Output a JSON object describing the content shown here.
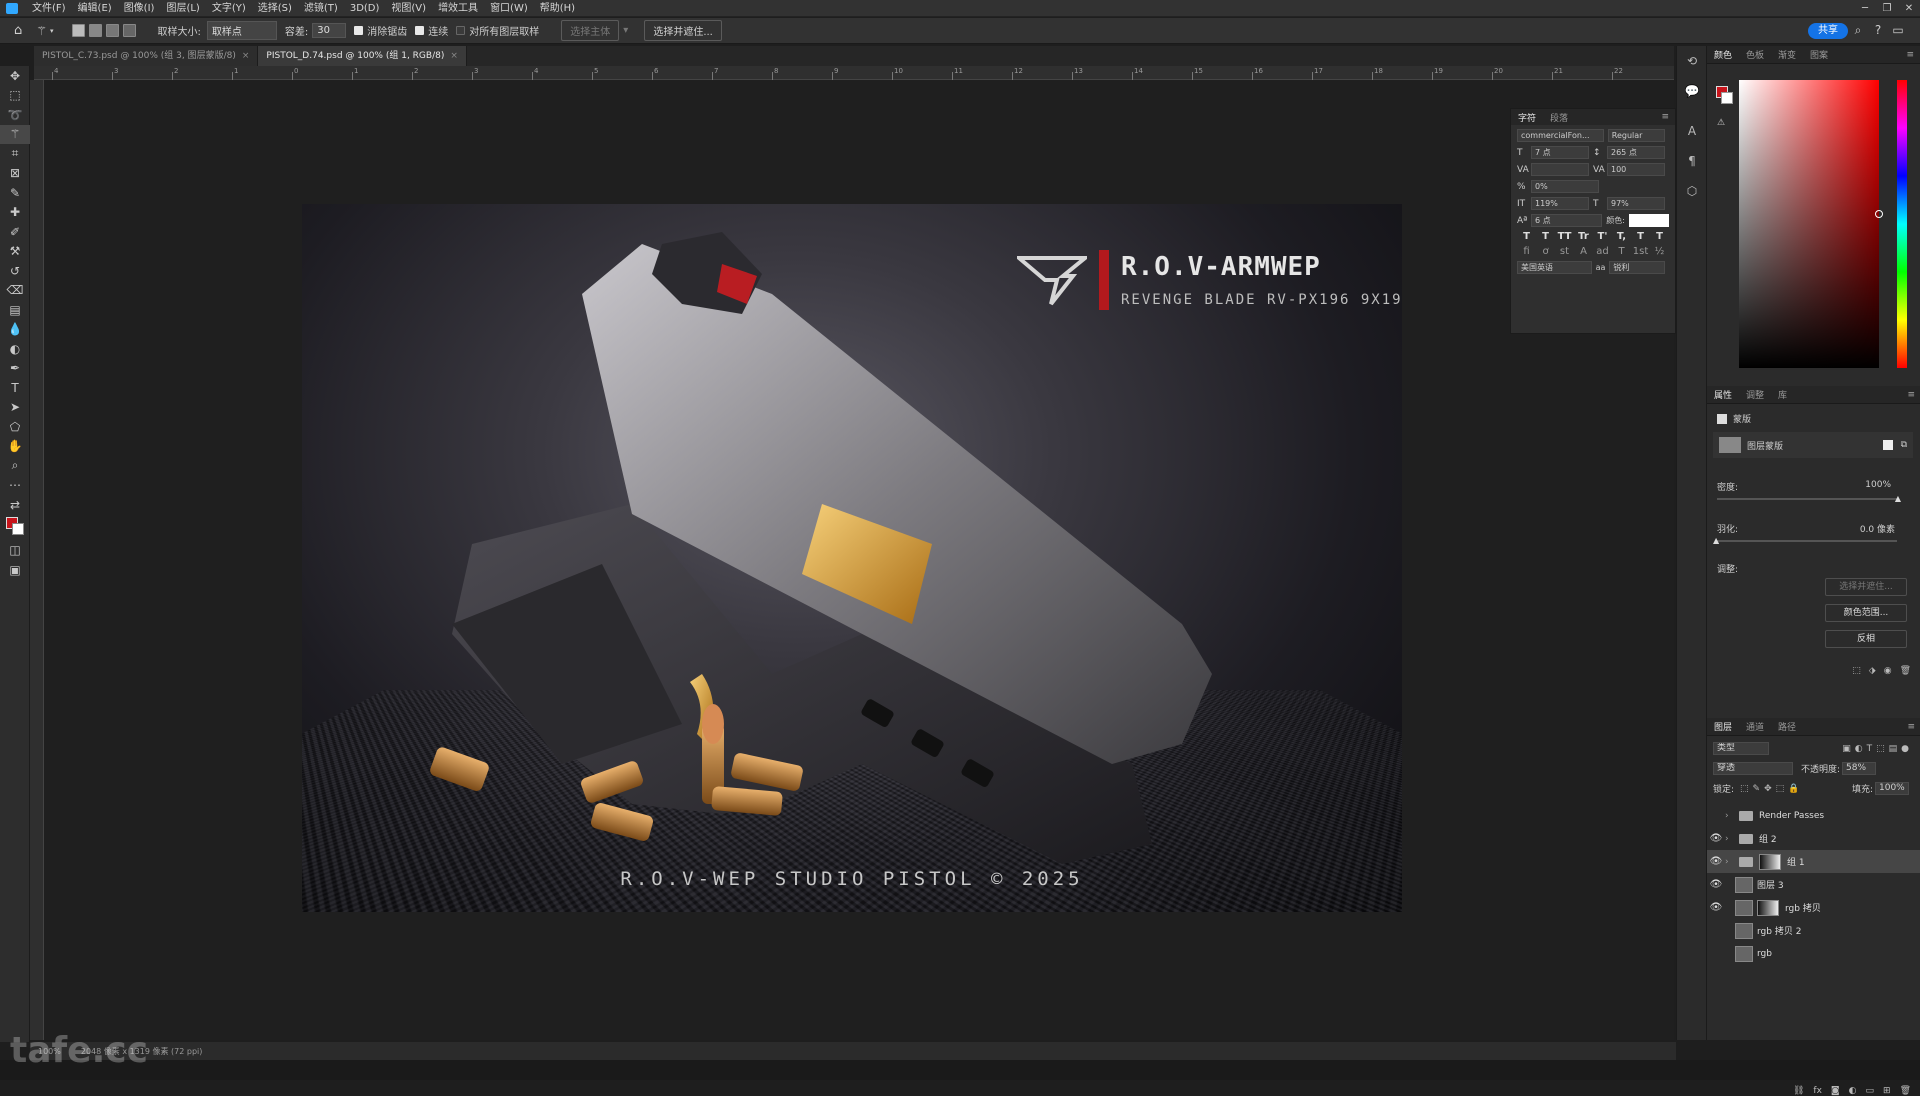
{
  "menu": {
    "items": [
      "文件(F)",
      "编辑(E)",
      "图像(I)",
      "图层(L)",
      "文字(Y)",
      "选择(S)",
      "滤镜(T)",
      "3D(D)",
      "视图(V)",
      "增效工具",
      "窗口(W)",
      "帮助(H)"
    ]
  },
  "options": {
    "sample_size_label": "取样大小:",
    "sample_size_value": "取样点",
    "tolerance_label": "容差:",
    "tolerance_value": "30",
    "antialias": "消除锯齿",
    "contiguous": "连续",
    "sample_all": "对所有图层取样",
    "select_subject": "选择主体",
    "select_and_mask": "选择并遮住..."
  },
  "share_label": "共享",
  "tabs": [
    {
      "label": "PISTOL_C.73.psd @ 100% (组 3, 图层蒙版/8)",
      "close": "×"
    },
    {
      "label": "PISTOL_D.74.psd @ 100% (组 1, RGB/8)",
      "close": "×"
    }
  ],
  "ruler_ticks": [
    "4",
    "3",
    "2",
    "1",
    "0",
    "1",
    "2",
    "3",
    "4",
    "5",
    "6",
    "7",
    "8",
    "9",
    "10",
    "11",
    "12",
    "13",
    "14",
    "15",
    "16",
    "17",
    "18",
    "19",
    "20",
    "21",
    "22"
  ],
  "artwork": {
    "brand_title": "R.O.V-ARMWEP",
    "brand_sub": "REVENGE BLADE RV-PX196 9X19",
    "footer": "R.O.V-WEP STUDIO PISTOL © 2025"
  },
  "character_panel": {
    "tabs": [
      "字符",
      "段落"
    ],
    "font": "commercialFon...",
    "style": "Regular",
    "size": "7 点",
    "leading": "265 点",
    "kerning": "",
    "tracking": "100",
    "scale_percent": "0%",
    "vscale": "119%",
    "hscale": "97%",
    "baseline": "6 点",
    "color_label": "颜色:",
    "language": "美国英语",
    "aa_label": "aa",
    "aa_value": "锐利",
    "styles": [
      "T",
      "T",
      "TT",
      "Tr",
      "T'",
      "T,",
      "T",
      "T"
    ],
    "ot": [
      "fi",
      "ơ",
      "st",
      "A",
      "ad",
      "T",
      "1st",
      "½"
    ]
  },
  "color_panel": {
    "tabs": [
      "颜色",
      "色板",
      "渐变",
      "图案"
    ],
    "fg": "#c7141b",
    "bg": "#ffffff"
  },
  "properties": {
    "tabs": [
      "属性",
      "调整",
      "库"
    ],
    "section": "蒙版",
    "layer_mask": "图层蒙版",
    "density_label": "密度:",
    "density_value": "100%",
    "feather_label": "羽化:",
    "feather_value": "0.0 像素",
    "adjust_label": "调整:",
    "btn_select_mask": "选择并遮住...",
    "btn_color_range": "颜色范围...",
    "btn_invert": "反相"
  },
  "layers_panel": {
    "tabs": [
      "图层",
      "通道",
      "路径"
    ],
    "filter": "类型",
    "blend": "穿透",
    "opacity_label": "不透明度:",
    "opacity_value": "58%",
    "lock_label": "锁定:",
    "fill_label": "填充:",
    "fill_value": "100%",
    "layers": [
      {
        "name": "Render Passes",
        "type": "folder",
        "visible": false,
        "selected": false
      },
      {
        "name": "组 2",
        "type": "folder",
        "visible": true,
        "selected": false
      },
      {
        "name": "组 1",
        "type": "folder-mask",
        "visible": true,
        "selected": true
      },
      {
        "name": "图层 3",
        "type": "image",
        "visible": true,
        "selected": false
      },
      {
        "name": "rgb 拷贝",
        "type": "image-mask",
        "visible": true,
        "selected": false
      },
      {
        "name": "rgb 拷贝 2",
        "type": "image",
        "visible": false,
        "selected": false
      },
      {
        "name": "rgb",
        "type": "image",
        "visible": false,
        "selected": false
      }
    ]
  },
  "status": {
    "zoom": "100%",
    "info": "2048 像素 x 1319 像素 (72 ppi)"
  },
  "watermark": "tafe.cc"
}
